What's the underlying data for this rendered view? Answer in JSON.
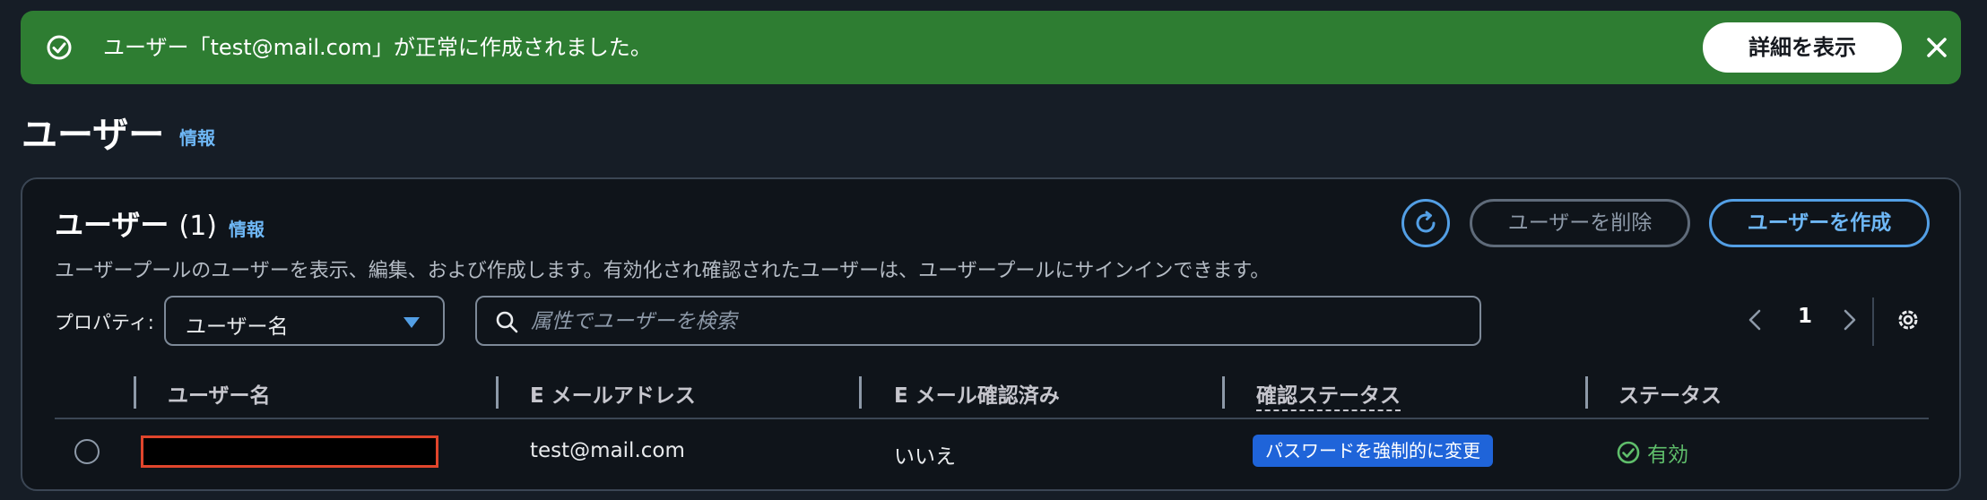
{
  "flash": {
    "message": "ユーザー「test@mail.com」が正常に作成されました。",
    "details_button": "詳細を表示",
    "color": "#2e7d32"
  },
  "header": {
    "title": "ユーザー",
    "info": "情報"
  },
  "panel": {
    "title": "ユーザー",
    "count": "(1)",
    "info": "情報",
    "description": "ユーザープールのユーザーを表示、編集、および作成します。有効化され確認されたユーザーは、ユーザープールにサインインできます。",
    "delete_button": "ユーザーを削除",
    "create_button": "ユーザーを作成"
  },
  "filter": {
    "property_label": "プロパティ:",
    "property_value": "ユーザー名",
    "search_placeholder": "属性でユーザーを検索"
  },
  "pagination": {
    "current_page": "1"
  },
  "table": {
    "columns": [
      "ユーザー名",
      "E メールアドレス",
      "E メール確認済み",
      "確認ステータス",
      "ステータス"
    ],
    "rows": [
      {
        "username": "",
        "email": "test@mail.com",
        "email_verified": "いいえ",
        "confirmation_status": "パスワードを強制的に変更",
        "status": "有効"
      }
    ]
  },
  "colors": {
    "accent": "#539fe5",
    "badge": "#1f64d9",
    "status_ok": "#5fbe6b",
    "redaction_border": "#e0452c"
  },
  "icons": [
    "check-circle-icon",
    "close-icon",
    "refresh-icon",
    "caret-down-icon",
    "search-icon",
    "chevron-left-icon",
    "chevron-right-icon",
    "gear-icon",
    "status-check-icon"
  ]
}
